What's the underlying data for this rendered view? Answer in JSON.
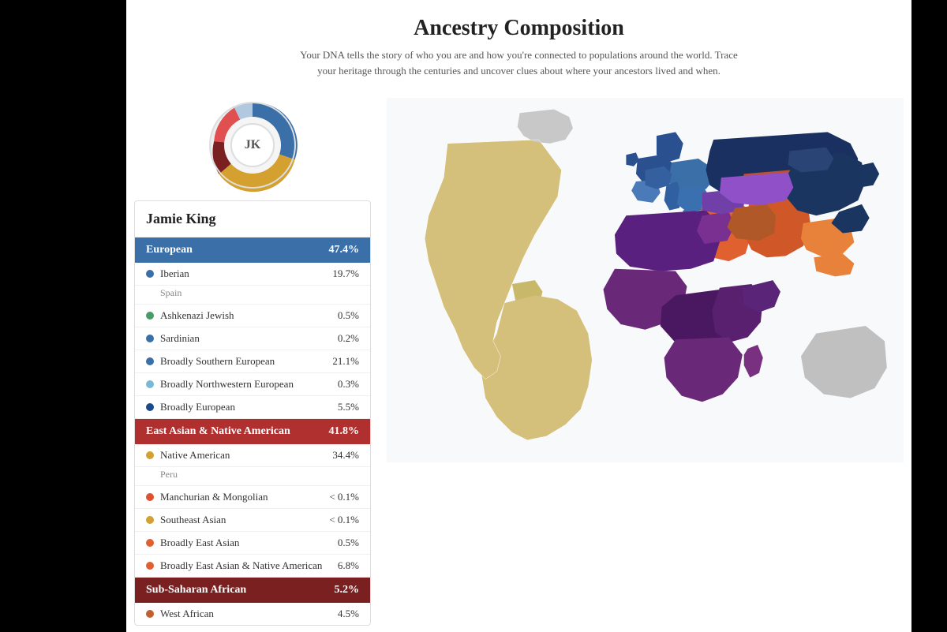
{
  "page": {
    "title": "Ancestry Composition",
    "subtitle": "Your DNA tells the story of who you are and how you're connected to populations around the world. Trace your heritage through the centuries and uncover clues about where your ancestors lived and when."
  },
  "person": {
    "name": "Jamie King",
    "initials": "JK"
  },
  "categories": [
    {
      "id": "european",
      "label": "European",
      "percentage": "47.4%",
      "color_class": "european",
      "items": [
        {
          "label": "Iberian",
          "value": "19.7%",
          "dot_color": "#3a6fa8",
          "sub_label": "Spain"
        },
        {
          "label": "Ashkenazi Jewish",
          "value": "0.5%",
          "dot_color": "#4a9a6a",
          "sub_label": ""
        },
        {
          "label": "Sardinian",
          "value": "0.2%",
          "dot_color": "#3a6fa8",
          "sub_label": ""
        },
        {
          "label": "Broadly Southern European",
          "value": "21.1%",
          "dot_color": "#3a6fa8",
          "sub_label": ""
        },
        {
          "label": "Broadly Northwestern European",
          "value": "0.3%",
          "dot_color": "#7ab8d8",
          "sub_label": ""
        },
        {
          "label": "Broadly European",
          "value": "5.5%",
          "dot_color": "#1a4a8a",
          "sub_label": ""
        }
      ]
    },
    {
      "id": "east-asian",
      "label": "East Asian & Native American",
      "percentage": "41.8%",
      "color_class": "east-asian",
      "items": [
        {
          "label": "Native American",
          "value": "34.4%",
          "dot_color": "#d4a030",
          "sub_label": "Peru"
        },
        {
          "label": "Manchurian & Mongolian",
          "value": "< 0.1%",
          "dot_color": "#e05030",
          "sub_label": ""
        },
        {
          "label": "Southeast Asian",
          "value": "< 0.1%",
          "dot_color": "#d4a030",
          "sub_label": ""
        },
        {
          "label": "Broadly East Asian",
          "value": "0.5%",
          "dot_color": "#e06030",
          "sub_label": ""
        },
        {
          "label": "Broadly East Asian & Native American",
          "value": "6.8%",
          "dot_color": "#e06030",
          "sub_label": ""
        }
      ]
    },
    {
      "id": "sub-saharan",
      "label": "Sub-Saharan African",
      "percentage": "5.2%",
      "color_class": "sub-saharan",
      "items": [
        {
          "label": "West African",
          "value": "4.5%",
          "dot_color": "#c06030",
          "sub_label": ""
        }
      ]
    }
  ]
}
